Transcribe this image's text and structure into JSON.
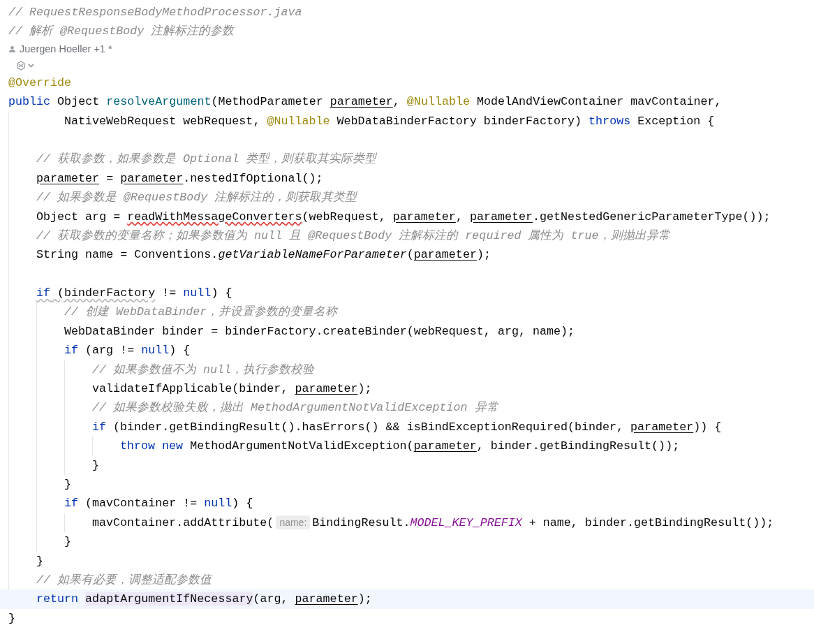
{
  "editor": {
    "lines": [
      {
        "kind": "comment",
        "text": "// RequestResponseBodyMethodProcessor.java"
      },
      {
        "kind": "comment",
        "text": "// 解析 @RequestBody 注解标注的参数"
      },
      {
        "kind": "author",
        "text": "Juergen Hoeller +1 *"
      },
      {
        "kind": "actions"
      },
      {
        "kind": "code",
        "tokens": [
          {
            "kind": "annotation",
            "text": "@Override"
          }
        ]
      },
      {
        "kind": "code",
        "tokens": [
          {
            "kind": "keyword",
            "text": "public"
          },
          {
            "kind": "plain",
            "text": " Object "
          },
          {
            "kind": "method",
            "text": "resolveArgument"
          },
          {
            "kind": "plain",
            "text": "(MethodParameter "
          },
          {
            "kind": "param",
            "text": "parameter"
          },
          {
            "kind": "plain",
            "text": ", "
          },
          {
            "kind": "annotation",
            "text": "@Nullable"
          },
          {
            "kind": "plain",
            "text": " ModelAndViewContainer mavContainer,"
          }
        ],
        "children": [
          {
            "kind": "continuation",
            "tokens": [
              {
                "kind": "plain",
                "text": "NativeWebRequest webRequest, "
              },
              {
                "kind": "annotation",
                "text": "@Nullable"
              },
              {
                "kind": "plain",
                "text": " WebDataBinderFactory binderFactory) "
              },
              {
                "kind": "keyword",
                "text": "throws"
              },
              {
                "kind": "plain",
                "text": " Exception {"
              }
            ]
          },
          {
            "kind": "blank"
          },
          {
            "kind": "comment",
            "text": "// 获取参数，如果参数是 Optional 类型，则获取其实际类型"
          },
          {
            "kind": "code",
            "tokens": [
              {
                "kind": "param",
                "text": "parameter"
              },
              {
                "kind": "plain",
                "text": " = "
              },
              {
                "kind": "param",
                "text": "parameter"
              },
              {
                "kind": "plain",
                "text": ".nestedIfOptional();"
              }
            ]
          },
          {
            "kind": "comment",
            "text": "// 如果参数是 @RequestBody 注解标注的，则获取其类型"
          },
          {
            "kind": "code",
            "tokens": [
              {
                "kind": "plain",
                "text": "Object arg = "
              },
              {
                "kind": "error",
                "text": "readWithMessageConverters"
              },
              {
                "kind": "plain",
                "text": "(webRequest, "
              },
              {
                "kind": "param",
                "text": "parameter"
              },
              {
                "kind": "plain",
                "text": ", "
              },
              {
                "kind": "param",
                "text": "parameter"
              },
              {
                "kind": "plain",
                "text": ".getNestedGenericParameterType());"
              }
            ]
          },
          {
            "kind": "comment",
            "text": "// 获取参数的变量名称；如果参数值为 null 且 @RequestBody 注解标注的 required 属性为 true，则抛出异常"
          },
          {
            "kind": "code",
            "tokens": [
              {
                "kind": "plain",
                "text": "String name = Conventions."
              },
              {
                "kind": "static",
                "text": "getVariableNameForParameter"
              },
              {
                "kind": "plain",
                "text": "("
              },
              {
                "kind": "param",
                "text": "parameter"
              },
              {
                "kind": "plain",
                "text": ");"
              }
            ]
          },
          {
            "kind": "blank"
          },
          {
            "kind": "code",
            "tokens": [
              {
                "kind": "warning-keyword",
                "text": "if"
              },
              {
                "kind": "warning",
                "text": " (binderFactory"
              },
              {
                "kind": "plain",
                "text": " != "
              },
              {
                "kind": "keyword",
                "text": "null"
              },
              {
                "kind": "plain",
                "text": ") {"
              }
            ],
            "children": [
              {
                "kind": "comment",
                "text": "// 创建 WebDataBinder，并设置参数的变量名称"
              },
              {
                "kind": "code",
                "tokens": [
                  {
                    "kind": "plain",
                    "text": "WebDataBinder binder = binderFactory.createBinder(webRequest, arg, name);"
                  }
                ]
              },
              {
                "kind": "code",
                "tokens": [
                  {
                    "kind": "keyword",
                    "text": "if"
                  },
                  {
                    "kind": "plain",
                    "text": " (arg != "
                  },
                  {
                    "kind": "keyword",
                    "text": "null"
                  },
                  {
                    "kind": "plain",
                    "text": ") {"
                  }
                ],
                "children": [
                  {
                    "kind": "comment",
                    "text": "// 如果参数值不为 null，执行参数校验"
                  },
                  {
                    "kind": "code",
                    "tokens": [
                      {
                        "kind": "plain",
                        "text": "validateIfApplicable(binder, "
                      },
                      {
                        "kind": "param",
                        "text": "parameter"
                      },
                      {
                        "kind": "plain",
                        "text": ");"
                      }
                    ]
                  },
                  {
                    "kind": "comment",
                    "text": "// 如果参数校验失败，抛出 MethodArgumentNotValidException 异常"
                  },
                  {
                    "kind": "code",
                    "tokens": [
                      {
                        "kind": "keyword",
                        "text": "if"
                      },
                      {
                        "kind": "plain",
                        "text": " (binder.getBindingResult().hasErrors() && isBindExceptionRequired(binder, "
                      },
                      {
                        "kind": "param",
                        "text": "parameter"
                      },
                      {
                        "kind": "plain",
                        "text": ")) {"
                      }
                    ],
                    "children": [
                      {
                        "kind": "code",
                        "tokens": [
                          {
                            "kind": "keyword",
                            "text": "throw "
                          },
                          {
                            "kind": "keyword",
                            "text": "new"
                          },
                          {
                            "kind": "plain",
                            "text": " MethodArgumentNotValidException("
                          },
                          {
                            "kind": "param",
                            "text": "parameter"
                          },
                          {
                            "kind": "plain",
                            "text": ", binder.getBindingResult());"
                          }
                        ]
                      }
                    ]
                  },
                  {
                    "kind": "code",
                    "tokens": [
                      {
                        "kind": "plain",
                        "text": "}"
                      }
                    ]
                  }
                ]
              },
              {
                "kind": "code",
                "tokens": [
                  {
                    "kind": "plain",
                    "text": "}"
                  }
                ]
              },
              {
                "kind": "code",
                "tokens": [
                  {
                    "kind": "keyword",
                    "text": "if"
                  },
                  {
                    "kind": "plain",
                    "text": " (mavContainer != "
                  },
                  {
                    "kind": "keyword",
                    "text": "null"
                  },
                  {
                    "kind": "plain",
                    "text": ") {"
                  }
                ],
                "children": [
                  {
                    "kind": "code",
                    "tokens": [
                      {
                        "kind": "plain",
                        "text": "mavContainer.addAttribute("
                      },
                      {
                        "kind": "hint",
                        "text": "name:"
                      },
                      {
                        "kind": "plain",
                        "text": "BindingResult."
                      },
                      {
                        "kind": "constant",
                        "text": "MODEL_KEY_PREFIX"
                      },
                      {
                        "kind": "plain",
                        "text": " + name, binder.getBindingResult());"
                      }
                    ]
                  }
                ]
              },
              {
                "kind": "code",
                "tokens": [
                  {
                    "kind": "plain",
                    "text": "}"
                  }
                ]
              }
            ]
          },
          {
            "kind": "code",
            "tokens": [
              {
                "kind": "plain",
                "text": "}"
              }
            ]
          },
          {
            "kind": "comment",
            "text": "// 如果有必要，调整适配参数值"
          },
          {
            "kind": "code",
            "current": true,
            "tokens": [
              {
                "kind": "keyword",
                "text": "return "
              },
              {
                "kind": "highlight",
                "text": "adaptArgumentIfNecessary"
              },
              {
                "kind": "plain",
                "text": "(arg, "
              },
              {
                "kind": "param",
                "text": "parameter"
              },
              {
                "kind": "plain",
                "text": ");"
              }
            ]
          }
        ]
      },
      {
        "kind": "code",
        "tokens": [
          {
            "kind": "plain",
            "text": "}"
          }
        ]
      }
    ]
  }
}
